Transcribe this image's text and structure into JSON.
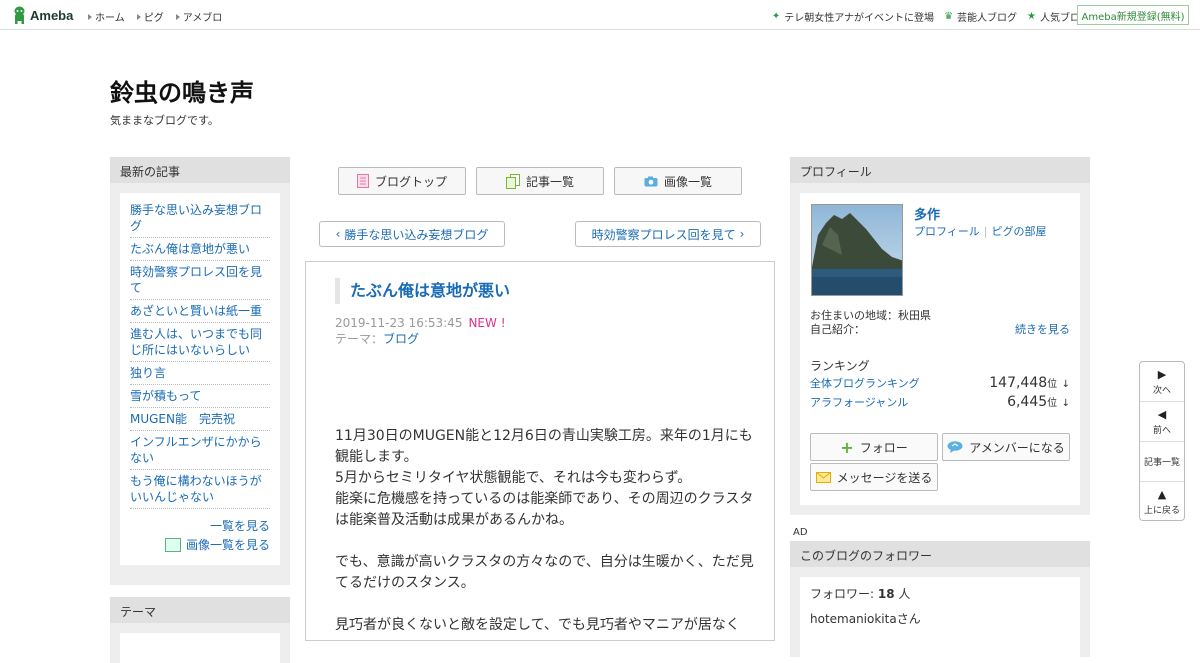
{
  "topbar": {
    "logo_text": "Ameba",
    "nav": [
      "ホーム",
      "ピグ",
      "アメブロ"
    ],
    "right_links": [
      {
        "icon": "sparkle-icon",
        "label": "テレ朝女性アナがイベントに登場"
      },
      {
        "icon": "crown-icon",
        "label": "芸能人ブログ"
      },
      {
        "icon": "star-icon",
        "label": "人気ブログ"
      }
    ],
    "register_label": "Ameba新規登録(無料)"
  },
  "blog": {
    "title": "鈴虫の鳴き声",
    "description": "気ままなブログです。"
  },
  "sidebar_left": {
    "latest_header": "最新の記事",
    "articles": [
      "勝手な思い込み妄想ブログ",
      "たぶん俺は意地が悪い",
      "時効警察プロレス回を見て",
      "あざといと賢いは紙一重",
      "進む人は、いつまでも同じ所にはいないらしい",
      "独り言",
      "雪が積もって",
      "MUGEN能　完売祝",
      "インフルエンザにかからない",
      "もう俺に構わないほうがいいんじゃない"
    ],
    "see_list": "一覧を見る",
    "see_images": "画像一覧を見る",
    "theme_header": "テーマ"
  },
  "nav_buttons": {
    "blog_top": "ブログトップ",
    "article_list": "記事一覧",
    "image_list": "画像一覧"
  },
  "pager": {
    "prev": "勝手な思い込み妄想ブログ",
    "next": "時効警察プロレス回を見て"
  },
  "entry": {
    "title": "たぶん俺は意地が悪い",
    "date": "2019-11-23 16:53:45",
    "new_badge": "NEW !",
    "theme_label": "テーマ：",
    "theme": "ブログ",
    "paragraphs": [
      [
        "11月30日のMUGEN能と12月6日の青山実験工房。来年の1月にも観能します。",
        "5月からセミリタイヤ状態観能で、それは今も変わらず。",
        "能楽に危機感を持っているのは能楽師であり、その周辺のクラスタは能楽普及活動は成果があるんかね。"
      ],
      [
        "でも、意識が高いクラスタの方々なので、自分は生暖かく、ただ見てるだけのスタンス。"
      ],
      [
        "見巧者が良くないと敵を設定して、でも見巧者やマニアが居なく"
      ]
    ]
  },
  "profile": {
    "header": "プロフィール",
    "name": "多作",
    "link_profile": "プロフィール",
    "link_pig": "ピグの部屋",
    "location_label": "お住まいの地域：",
    "location": "秋田県",
    "intro_label": "自己紹介：",
    "intro_more": "続きを見る",
    "ranking_label": "ランキング",
    "rankings": [
      {
        "label": "全体ブログランキング",
        "value": "147,448",
        "unit": "位",
        "arrow": "↓"
      },
      {
        "label": "アラフォージャンル",
        "value": "6,445",
        "unit": "位",
        "arrow": "↓"
      }
    ],
    "follow": "フォロー",
    "amember": "アメンバーになる",
    "message": "メッセージを送る"
  },
  "ad_label": "AD",
  "followers": {
    "header": "このブログのフォロワー",
    "count_label": "フォロワー:",
    "count": "18",
    "count_unit": "人",
    "first_follower": "hotemaniokitaさん"
  },
  "side_nav": {
    "next": "次へ",
    "prev": "前へ",
    "list": "記事一覧",
    "top": "上に戻る"
  },
  "colors": {
    "link": "#1a6bb5",
    "ameba_green": "#2f9a3f",
    "new_badge": "#e0318a"
  }
}
